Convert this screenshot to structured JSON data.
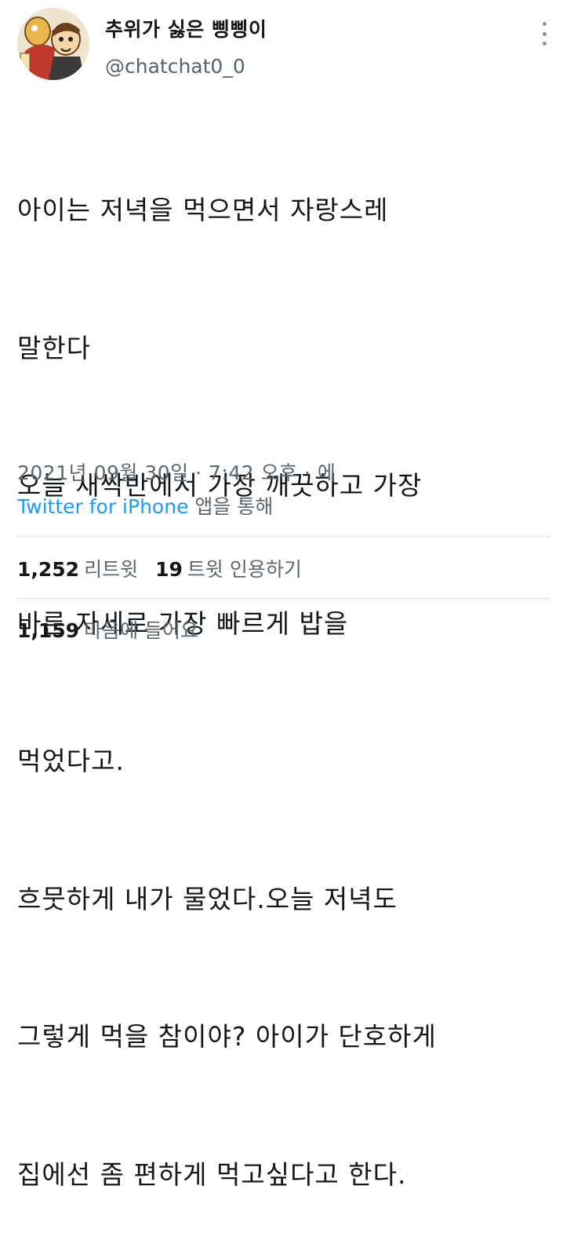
{
  "user": {
    "display_name": "추위가 싫은 삥삥이",
    "handle": "@chatchat0_0",
    "avatar": "cartoon-avatar"
  },
  "more_menu": {
    "icon": "vertical-ellipsis-icon"
  },
  "tweet": {
    "lines": [
      "아이는 저녁을 먹으면서 자랑스레",
      "말한다",
      "오늘 새싹반에서 가장 깨끗하고 가장",
      "바른 자세로 가장 빠르게 밥을",
      "먹었다고.",
      "흐뭇하게 내가 물었다.오늘 저녁도",
      "그렇게 먹을 참이야? 아이가 단호하게",
      "집에선 좀 편하게 먹고싶다고 한다."
    ],
    "timestamp": "2021년 09월 30일 · 7:42 오후 · 에",
    "source_app": "Twitter for iPhone",
    "source_suffix": " 앱을 통해"
  },
  "stats": {
    "retweets_count": "1,252",
    "retweets_label": "리트윗",
    "quotes_count": "19",
    "quotes_label": "트윗 인용하기",
    "likes_count": "1,159",
    "likes_label": "마음에 들어요"
  },
  "colors": {
    "link": "#1d9bf0",
    "secondary_text": "#5b6670",
    "divider": "#dfe3e6"
  }
}
